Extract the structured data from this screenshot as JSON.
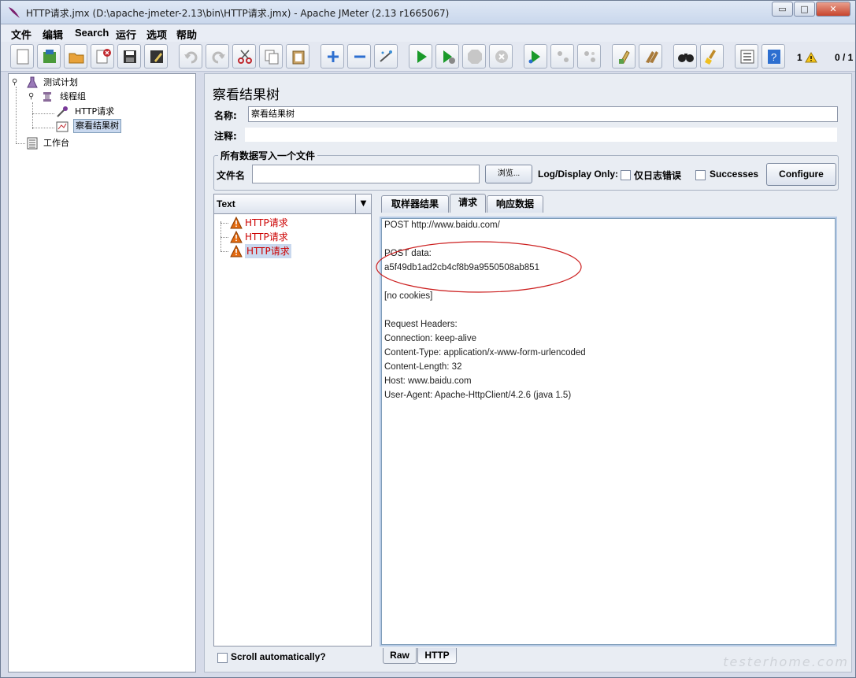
{
  "window": {
    "title": "HTTP请求.jmx (D:\\apache-jmeter-2.13\\bin\\HTTP请求.jmx) - Apache JMeter (2.13 r1665067)",
    "minimize": "▭",
    "maximize": "□",
    "close": "✕"
  },
  "menu": [
    "文件",
    "编辑",
    "Search",
    "运行",
    "选项",
    "帮助"
  ],
  "toolbar": {
    "error_count": "1",
    "thread_count": "0 / 1"
  },
  "tree": {
    "test_plan": "测试计划",
    "thread_group": "线程组",
    "http_request": "HTTP请求",
    "results_tree": "察看结果树",
    "workbench": "工作台"
  },
  "panel": {
    "title": "察看结果树",
    "name_label": "名称:",
    "name_value": "察看结果树",
    "comment_label": "注释:",
    "comment_value": "",
    "group_title": "所有数据写入一个文件",
    "file_label": "文件名",
    "file_value": "",
    "browse_label": "浏览...",
    "log_display_label": "Log/Display Only:",
    "errors_only_label": "仅日志错误",
    "successes_label": "Successes",
    "configure_label": "Configure"
  },
  "renderer": {
    "selected": "Text",
    "scroll_auto_label": "Scroll automatically?"
  },
  "results": [
    {
      "label": "HTTP请求",
      "selected": false
    },
    {
      "label": "HTTP请求",
      "selected": false
    },
    {
      "label": "HTTP请求",
      "selected": true
    }
  ],
  "tabs": [
    "取样器结果",
    "请求",
    "响应数据"
  ],
  "active_tab": "请求",
  "request_text": [
    "POST http://www.baidu.com/",
    "",
    "POST data:",
    "a5f49db1ad2cb4cf8b9a9550508ab851",
    "",
    "[no cookies]",
    "",
    "Request Headers:",
    "Connection: keep-alive",
    "Content-Type: application/x-www-form-urlencoded",
    "Content-Length: 32",
    "Host: www.baidu.com",
    "User-Agent: Apache-HttpClient/4.2.6 (java 1.5)"
  ],
  "bottom_tabs": [
    "Raw",
    "HTTP"
  ],
  "watermark": "testerhome.com",
  "colors": {
    "error_text": "#cc0000",
    "highlight_ellipse": "#cc1f1f",
    "selection": "#c9d8ee"
  }
}
